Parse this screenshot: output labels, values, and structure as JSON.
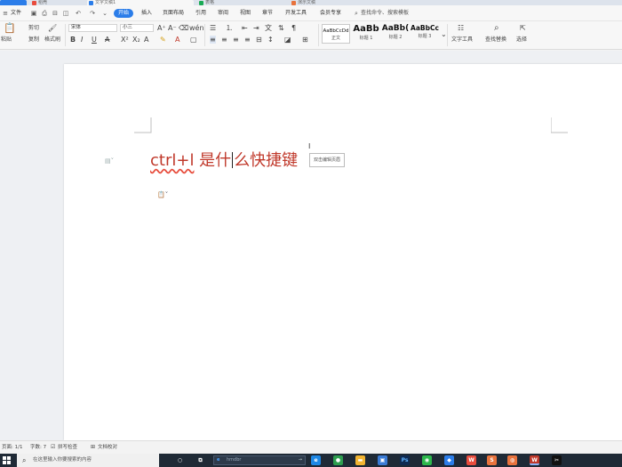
{
  "tabs": [
    {
      "label": "",
      "color": "#2b7de9"
    },
    {
      "label": "稻壳",
      "color": "#e84c3d"
    },
    {
      "label": "文字文稿1",
      "color": "#2b7de9"
    },
    {
      "label": "表格",
      "color": "#1aaa55"
    },
    {
      "label": "演示文稿",
      "color": "#e8733d"
    }
  ],
  "menu": {
    "file": "文件",
    "start": "开始",
    "items": [
      "插入",
      "页面布局",
      "引用",
      "审阅",
      "视图",
      "章节",
      "开发工具",
      "会员专享"
    ],
    "search_placeholder": "查找命令、搜索模板"
  },
  "ribbon": {
    "paste": "粘贴",
    "cut": "剪切",
    "copy": "复制",
    "format_painter": "格式刷",
    "font_name": "宋体",
    "font_size": "小三",
    "styles": [
      {
        "preview": "AaBbCcDd",
        "caption": "正文"
      },
      {
        "preview": "AaBb",
        "caption": "标题 1"
      },
      {
        "preview": "AaBb(",
        "caption": "标题 2"
      },
      {
        "preview": "AaBbCc",
        "caption": "标题 3"
      }
    ],
    "text_tools": "文字工具",
    "find_replace": "查找替换",
    "select": "选择"
  },
  "document": {
    "heading_latin": "ctrl+l",
    "heading_before_caret": " 是什",
    "heading_after_caret": "么快捷键",
    "tooltip": "双击编辑页眉"
  },
  "status": {
    "page": "页面: 1/1",
    "words": "字数: 7",
    "spellcheck": "拼写检查",
    "proofread": "文档校对"
  },
  "taskbar": {
    "search_placeholder": "在这里输入你要搜索的内容",
    "address_placeholder": "hmdbr",
    "apps": [
      {
        "name": "cortana-icon",
        "label": "○",
        "color": "transparent"
      },
      {
        "name": "task-view-icon",
        "label": "⧉",
        "color": "transparent"
      },
      {
        "name": "edge-icon",
        "label": "e",
        "color": "#1e88e5"
      },
      {
        "name": "chrome-icon",
        "label": "●",
        "color": "#2e9e4f"
      },
      {
        "name": "file-explorer-icon",
        "label": "▬",
        "color": "#f2b431"
      },
      {
        "name": "store-icon",
        "label": "▣",
        "color": "#3a7bd5"
      },
      {
        "name": "photoshop-icon",
        "label": "Ps",
        "color": "#0f2a52"
      },
      {
        "name": "wechat-icon",
        "label": "◉",
        "color": "#2db84c"
      },
      {
        "name": "paint-icon",
        "label": "◆",
        "color": "#2b7de9"
      },
      {
        "name": "wps-icon",
        "label": "W",
        "color": "#e84c3d"
      },
      {
        "name": "wps-spreadsheet-icon",
        "label": "S",
        "color": "#e8733d"
      },
      {
        "name": "firefox-icon",
        "label": "◍",
        "color": "#e8733d"
      },
      {
        "name": "wps-writer-icon",
        "label": "W",
        "color": "#c0392b"
      },
      {
        "name": "capcut-icon",
        "label": "✂",
        "color": "#111111"
      }
    ]
  }
}
